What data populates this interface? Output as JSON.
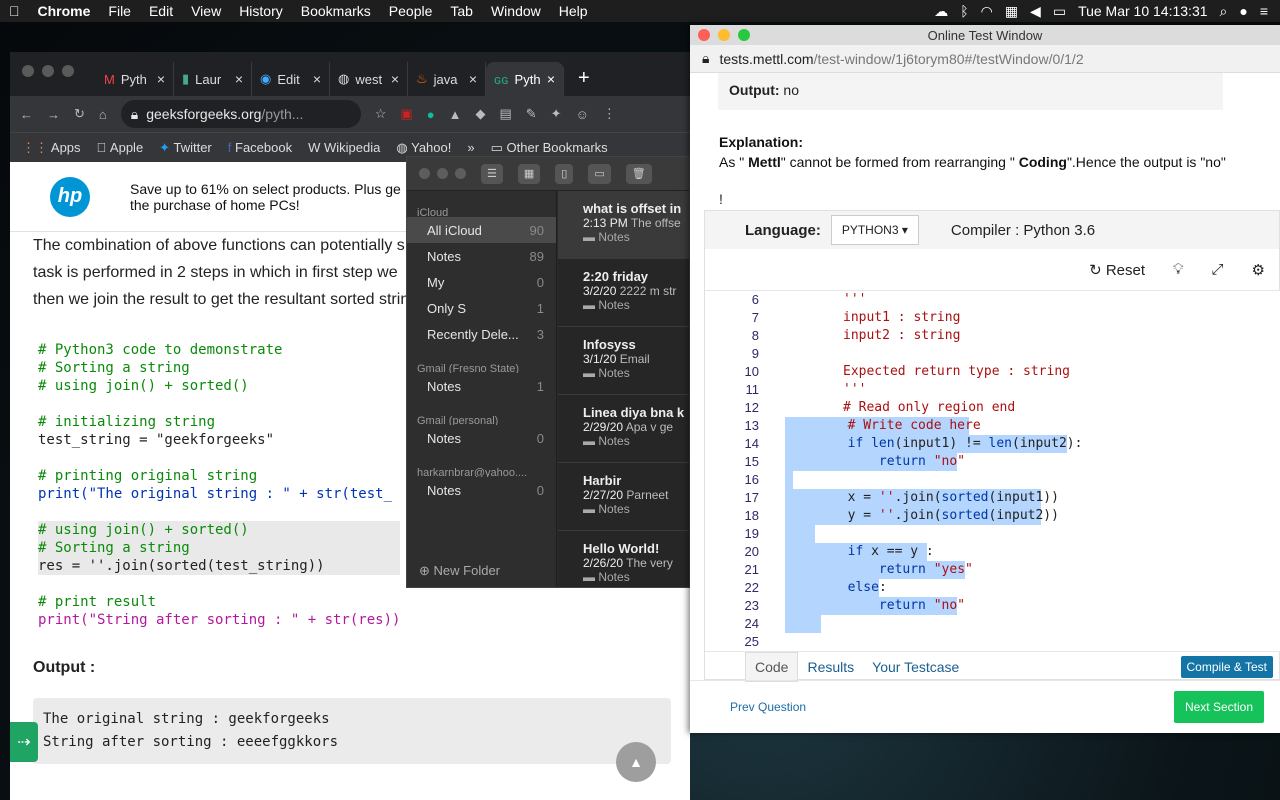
{
  "menubar": {
    "app": "Chrome",
    "items": [
      "File",
      "Edit",
      "View",
      "History",
      "Bookmarks",
      "People",
      "Tab",
      "Window",
      "Help"
    ],
    "clock": "Tue Mar 10  14:13:31"
  },
  "chrome": {
    "tabs": [
      {
        "label": "Pyth"
      },
      {
        "label": "Laur"
      },
      {
        "label": "Edit"
      },
      {
        "label": "west"
      },
      {
        "label": "java"
      },
      {
        "label": "Pyth"
      }
    ],
    "url_host": "geeksforgeeks.org",
    "url_path": "/pyth...",
    "bookmarks": [
      "Apps",
      "Apple",
      "Twitter",
      "Facebook",
      "Wikipedia",
      "Yahoo!"
    ],
    "other_bookmarks": "Other Bookmarks"
  },
  "gfg": {
    "ad_line1": "Save up to 61% on select products. Plus ge",
    "ad_line2": "the purchase of home PCs!",
    "hp_logo": "hp",
    "para": [
      "The combination of above functions can potentially s",
      "task is performed in 2 steps in which in first step we",
      "then we join the result to get the resultant sorted strin"
    ],
    "code": [
      "# Python3 code to demonstrate",
      "# Sorting a string",
      "# using join() + sorted()",
      "",
      "# initializing string",
      "test_string = \"geekforgeeks\"",
      "",
      "# printing original string",
      "print(\"The original string : \" + str(test_",
      "",
      "# using join() + sorted()",
      "# Sorting a string",
      "res = ''.join(sorted(test_string))",
      "",
      "# print result",
      "print(\"String after sorting : \" + str(res))"
    ],
    "output_label": "Output :",
    "output_lines": [
      "The original string : geekforgeeks",
      "String after sorting : eeeefggkkors"
    ]
  },
  "notes": {
    "groups": [
      {
        "title": "iCloud",
        "items": [
          {
            "label": "All iCloud",
            "count": "90"
          },
          {
            "label": "Notes",
            "count": "89"
          },
          {
            "label": "My",
            "count": "0"
          },
          {
            "label": "Only S",
            "count": "1"
          },
          {
            "label": "Recently Dele...",
            "count": "3"
          }
        ]
      },
      {
        "title": "Gmail (Fresno State)",
        "items": [
          {
            "label": "Notes",
            "count": "1"
          }
        ]
      },
      {
        "title": "Gmail (personal)",
        "items": [
          {
            "label": "Notes",
            "count": "0"
          }
        ]
      },
      {
        "title": "harkarnbrar@yahoo....",
        "items": [
          {
            "label": "Notes",
            "count": "0"
          }
        ]
      }
    ],
    "new_folder": "New Folder",
    "list": [
      {
        "title": "what is offset in",
        "date": "2:13 PM",
        "snippet": "The offse",
        "folder": "Notes"
      },
      {
        "title": "2:20 friday",
        "date": "3/2/20",
        "snippet": "2222 m str",
        "folder": "Notes"
      },
      {
        "title": "Infosyss",
        "date": "3/1/20",
        "snippet": "Email",
        "folder": "Notes"
      },
      {
        "title": "Linea diya bna k",
        "date": "2/29/20",
        "snippet": "Apa v ge",
        "folder": "Notes"
      },
      {
        "title": "Harbir",
        "date": "2/27/20",
        "snippet": "Parneet",
        "folder": "Notes"
      },
      {
        "title": "Hello World!",
        "date": "2/26/20",
        "snippet": "The very",
        "folder": "Notes"
      }
    ]
  },
  "test": {
    "window_title": "Online Test Window",
    "url_host": "tests.mettl.com",
    "url_path": "/test-window/1j6torym80#/testWindow/0/1/2",
    "output_label": "Output:",
    "output_value": "no",
    "explanation_label": "Explanation:",
    "explanation_parts": [
      "As \" ",
      "Mettl",
      "\" cannot be formed from rearranging \" ",
      "Coding",
      "\".Hence the output is \"no\""
    ],
    "exclamation": "!",
    "language_label": "Language:",
    "language_value": "PYTHON3",
    "compiler": "Compiler : Python 3.6",
    "reset": "Reset",
    "line_numbers": [
      "6",
      "7",
      "8",
      "9",
      "10",
      "11",
      "12",
      "13",
      "14",
      "15",
      "16",
      "17",
      "18",
      "19",
      "20",
      "21",
      "22",
      "23",
      "24",
      "25"
    ],
    "tabs": [
      "Code",
      "Results",
      "Your Testcase"
    ],
    "compile_btn": "Compile & Test",
    "prev": "Prev Question",
    "next": "Next Section"
  }
}
